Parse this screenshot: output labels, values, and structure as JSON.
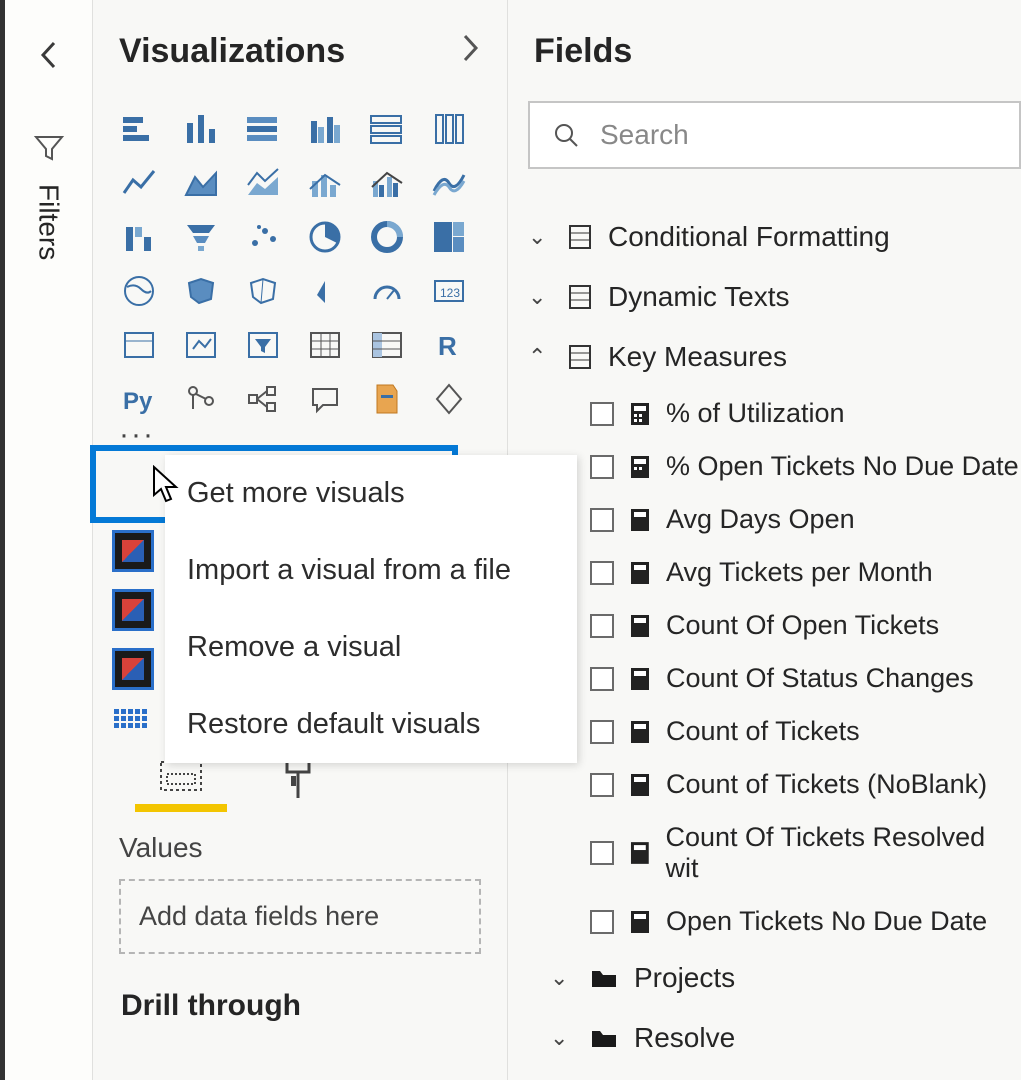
{
  "filters": {
    "label": "Filters"
  },
  "visualizations": {
    "title": "Visualizations",
    "ellipsis": "···",
    "icons": [
      "stacked-bar",
      "clustered-bar",
      "stacked-column",
      "clustered-column",
      "100-stacked-bar",
      "100-stacked-column",
      "column-combo",
      "line",
      "area",
      "stacked-area",
      "line-column",
      "line-clustered",
      "ribbon",
      "waterfall",
      "funnel-bar",
      "funnel",
      "scatter",
      "pie",
      "donut",
      "treemap",
      "map",
      "globe",
      "filled-map",
      "shape-map",
      "gauge",
      "kpi",
      "card",
      "multi-row",
      "slicer",
      "table",
      "matrix",
      "r-visual",
      "py-visual",
      "key-influencer",
      "decomposition",
      "qa",
      "paginated",
      "power-apps"
    ]
  },
  "context_menu": {
    "items": [
      "Get more visuals",
      "Import a visual from a file",
      "Remove a visual",
      "Restore default visuals"
    ]
  },
  "tabs": {
    "fields_tab": "fields",
    "format_tab": "format"
  },
  "values_section": {
    "label": "Values",
    "placeholder": "Add data fields here"
  },
  "drill": {
    "label": "Drill through"
  },
  "fields": {
    "title": "Fields",
    "search_placeholder": "Search",
    "tables": [
      {
        "name": "Conditional Formatting",
        "expanded": false,
        "type": "table"
      },
      {
        "name": "Dynamic Texts",
        "expanded": false,
        "type": "table"
      },
      {
        "name": "Key Measures",
        "expanded": true,
        "type": "table",
        "fields": [
          "% of Utilization",
          "% Open Tickets No Due Date",
          "Avg Days Open",
          "Avg Tickets per Month",
          "Count Of Open Tickets",
          "Count Of Status Changes",
          "Count of Tickets",
          "Count of Tickets (NoBlank)",
          "Count Of Tickets Resolved wit",
          "Open Tickets No Due Date"
        ]
      },
      {
        "name": "Projects",
        "expanded": false,
        "type": "folder"
      },
      {
        "name": "Resolve",
        "expanded": false,
        "type": "folder"
      }
    ]
  }
}
